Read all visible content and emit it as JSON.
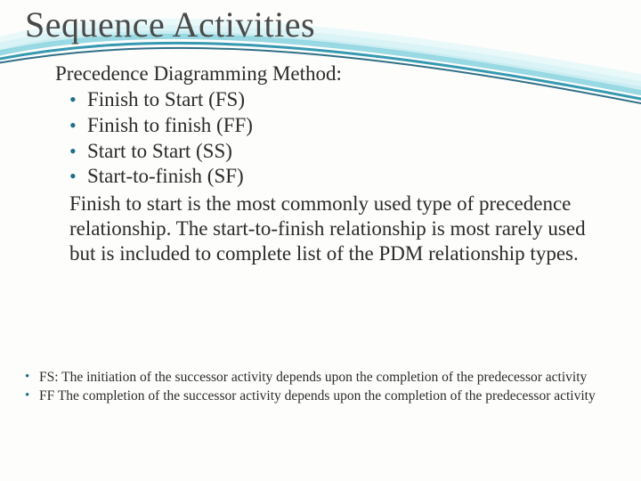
{
  "title": "Sequence Activities",
  "subtitle": "Precedence Diagramming Method:",
  "main_items": {
    "0": "Finish to Start (FS)",
    "1": "Finish to finish (FF)",
    "2": "Start to Start (SS)",
    "3": "Start-to-finish (SF)"
  },
  "paragraph": "Finish to start is the most commonly used type of precedence relationship. The start-to-finish relationship is most rarely used but is included to complete list of the PDM relationship types.",
  "footnotes": {
    "0": "FS: The initiation of the successor activity depends upon the completion of the predecessor activity",
    "1": "FF The completion of the successor activity depends upon the completion of the predecessor activity"
  },
  "colors": {
    "accent": "#1f6e8c",
    "swoosh_light": "#a8e0e8",
    "swoosh_dark": "#1f6e8c"
  }
}
